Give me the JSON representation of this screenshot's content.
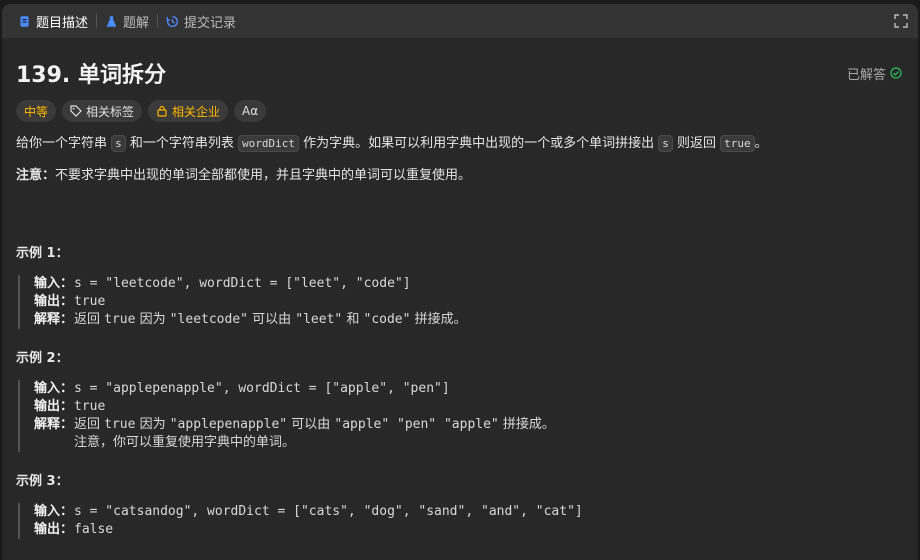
{
  "tabs": [
    {
      "label": "题目描述",
      "icon": "document-icon",
      "active": true
    },
    {
      "label": "题解",
      "icon": "flask-icon",
      "active": false
    },
    {
      "label": "提交记录",
      "icon": "history-icon",
      "active": false
    }
  ],
  "problem": {
    "title": "139. 单词拆分",
    "status": "已解答",
    "tags": {
      "difficulty": "中等",
      "topics": "相关标签",
      "companies": "相关企业",
      "font": "Aα"
    },
    "desc": {
      "p1": "给你一个字符串 ",
      "c1": "s",
      "p2": " 和一个字符串列表 ",
      "c2": "wordDict",
      "p3": " 作为字典。如果可以利用字典中出现的一个或多个单词拼接出 ",
      "c3": "s",
      "p4": " 则返回 ",
      "c4": "true",
      "p5": "。"
    },
    "note_label": "注意：",
    "note_text": "不要求字典中出现的单词全部都使用，并且字典中的单词可以重复使用。"
  },
  "labels": {
    "input": "输入：",
    "output": "输出：",
    "explain": "解释："
  },
  "examples": [
    {
      "title": "示例 1：",
      "input": "s = \"leetcode\", wordDict = [\"leet\", \"code\"]",
      "output": "true",
      "explain_a": "返回 ",
      "explain_b": "true",
      "explain_c": " 因为 ",
      "explain_d": "\"leetcode\"",
      "explain_e": " 可以由 ",
      "explain_f": "\"leet\"",
      "explain_g": " 和 ",
      "explain_h": "\"code\"",
      "explain_i": " 拼接成。"
    },
    {
      "title": "示例 2：",
      "input": "s = \"applepenapple\", wordDict = [\"apple\", \"pen\"]",
      "output": "true",
      "explain_a": "返回 ",
      "explain_b": "true",
      "explain_c": " 因为 ",
      "explain_d": "\"applepenapple\"",
      "explain_e": " 可以由 ",
      "explain_f": "\"apple\" \"pen\" \"apple\"",
      "explain_i": " 拼接成。",
      "explain_note": "注意，你可以重复使用字典中的单词。"
    },
    {
      "title": "示例 3：",
      "input": "s = \"catsandog\", wordDict = [\"cats\", \"dog\", \"sand\", \"and\", \"cat\"]",
      "output": "false"
    }
  ]
}
